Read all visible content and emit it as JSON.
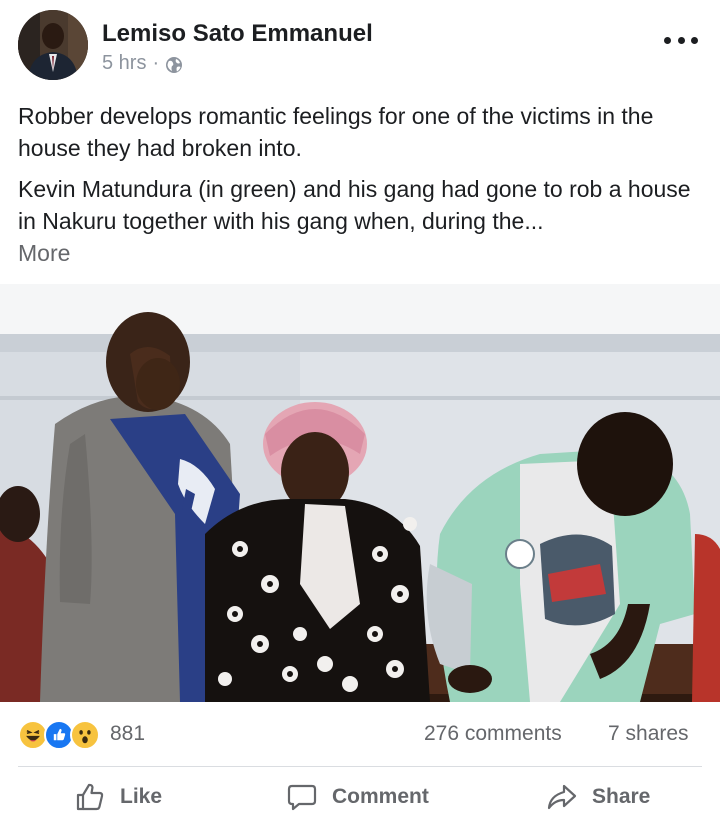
{
  "post": {
    "author": "Lemiso Sato Emmanuel",
    "time": "5 hrs",
    "separator": "·",
    "privacy_icon": "globe-icon",
    "text_paragraph_1": "Robber develops romantic feelings for one of the victims in the house they had broken into.",
    "text_paragraph_2": "Kevin Matundura (in green) and his gang had gone to rob a house in Nakuru together with his gang when, during the...",
    "more_link": "More"
  },
  "reactions": {
    "icons": [
      "haha-icon",
      "like-icon",
      "wow-icon"
    ],
    "count": "881",
    "comments": "276 comments",
    "shares": "7 shares"
  },
  "actions": {
    "like_label": "Like",
    "comment_label": "Comment",
    "share_label": "Share"
  },
  "colors": {
    "like_blue": "#1877f2",
    "reaction_yellow": "#f7c33f",
    "secondary_text": "#65676b",
    "meta_text": "#8d949e"
  }
}
